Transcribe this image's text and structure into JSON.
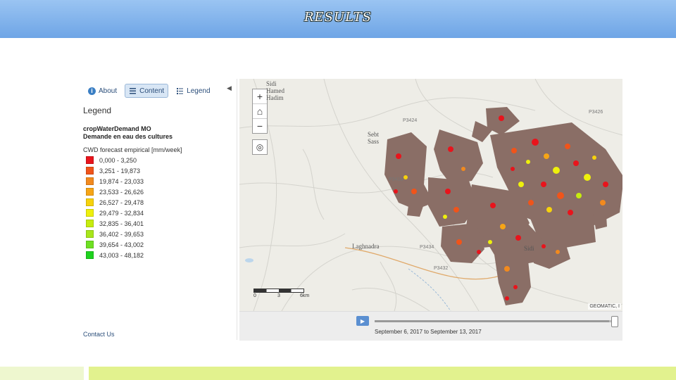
{
  "slide": {
    "title": "RESULTS"
  },
  "sidebar": {
    "tabs": [
      {
        "label": "About",
        "icon": "info-icon"
      },
      {
        "label": "Content",
        "icon": "content-list-icon",
        "active": true
      },
      {
        "label": "Legend",
        "icon": "legend-list-icon"
      }
    ],
    "collapse_icon": "collapse-arrow-icon",
    "legend_title": "Legend",
    "layer_name_a": "cropWaterDemand MO",
    "layer_name_b": "Demande en eau des cultures",
    "layer_field": "CWD forecast empirical [mm/week]",
    "legend_items": [
      {
        "label": "0,000 - 3,250",
        "color": "#e8141c"
      },
      {
        "label": "3,251 - 19,873",
        "color": "#f0541a"
      },
      {
        "label": "19,874 - 23,033",
        "color": "#f28a1e"
      },
      {
        "label": "23,533 - 26,626",
        "color": "#f6a516"
      },
      {
        "label": "26,527 - 29,478",
        "color": "#f6d20c"
      },
      {
        "label": "29,479 - 32,834",
        "color": "#eef00c"
      },
      {
        "label": "32,835 - 36,401",
        "color": "#c6ec0e"
      },
      {
        "label": "36,402 - 39,653",
        "color": "#a8e61a"
      },
      {
        "label": "39,654 - 43,002",
        "color": "#6ee022"
      },
      {
        "label": "43,003 - 48,182",
        "color": "#1ed21e"
      }
    ],
    "contact_link": "Contact Us"
  },
  "map": {
    "zoom_in": "+",
    "home": "⌂",
    "zoom_out": "−",
    "locate": "◎",
    "places": [
      "Sidi Hamed Hadim",
      "Sebt Sass",
      "Laghnadra",
      "Sidi"
    ],
    "roads": [
      "P3426",
      "P3424",
      "P3418",
      "P3434",
      "P3432"
    ],
    "scale_labels": [
      "0",
      "3",
      "6km"
    ],
    "attribution": "GEOMATIC, I",
    "cwd_color": "#8a6e66"
  },
  "time_slider": {
    "play_icon": "play-icon",
    "period_text": "September 6, 2017 to September 13, 2017",
    "position": 0.98
  }
}
